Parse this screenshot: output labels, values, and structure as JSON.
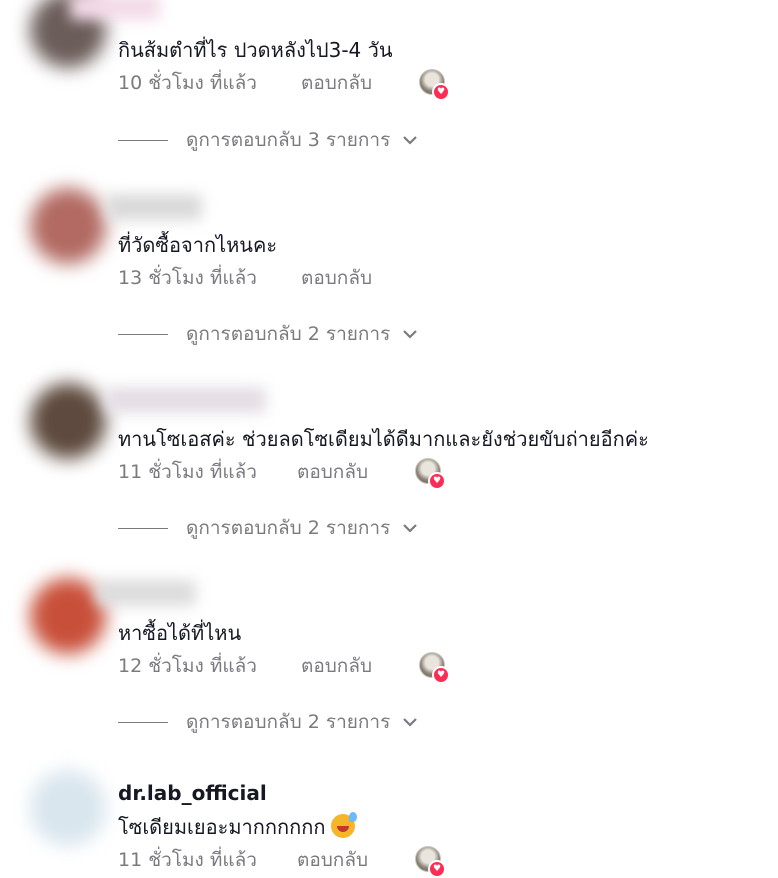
{
  "comments": [
    {
      "username": "",
      "text": "กินส้มตำที่ไร ปวดหลังไป3-4 วัน",
      "time": "10 ชั่วโมง ที่แล้ว",
      "reply_label": "ตอบกลับ",
      "liked_by_creator": true,
      "view_replies": "ดูการตอบกลับ 3 รายการ",
      "avatar_color": "#6b5d5a"
    },
    {
      "username": "",
      "text": "ที่วัดซื้อจากไหนคะ",
      "time": "13 ชั่วโมง ที่แล้ว",
      "reply_label": "ตอบกลับ",
      "liked_by_creator": false,
      "view_replies": "ดูการตอบกลับ 2 รายการ",
      "avatar_color": "#b26a62"
    },
    {
      "username": "",
      "text": "ทานโซเอสค่ะ ช่วยลดโซเดียมได้ดีมากและยังช่วยขับถ่ายอีกค่ะ",
      "time": "11 ชั่วโมง ที่แล้ว",
      "reply_label": "ตอบกลับ",
      "liked_by_creator": true,
      "view_replies": "ดูการตอบกลับ 2 รายการ",
      "avatar_color": "#5e4a3e"
    },
    {
      "username": "",
      "text": "หาซื้อได้ที่ไหน",
      "time": "12 ชั่วโมง ที่แล้ว",
      "reply_label": "ตอบกลับ",
      "liked_by_creator": true,
      "view_replies": "ดูการตอบกลับ 2 รายการ",
      "avatar_color": "#c8503a"
    },
    {
      "username": "dr.lab_official",
      "text": "โซเดียมเยอะมากกกกกก",
      "time": "11 ชั่วโมง ที่แล้ว",
      "reply_label": "ตอบกลับ",
      "liked_by_creator": true,
      "avatar_color": "#d9e6ee"
    }
  ],
  "colors": {
    "heart": "#fe2c55",
    "muted": "#7a7b80"
  },
  "icons": {
    "chevron": "chevron-down-icon",
    "liked": "creator-liked-icon",
    "emoji": "grinning-sweat-emoji-icon"
  }
}
